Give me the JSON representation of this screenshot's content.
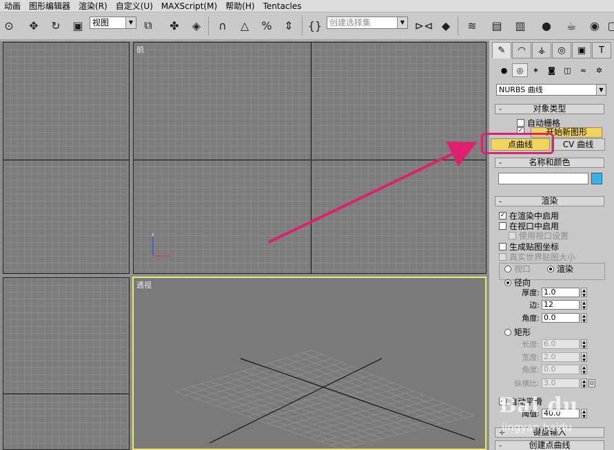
{
  "menu": [
    "动画",
    "图形编辑器",
    "渲染(R)",
    "自定义(U)",
    "MAXScript(M)",
    "帮助(H)",
    "Tentacles"
  ],
  "toolbar": {
    "view_combo": "视图",
    "selection_set_placeholder": "创建选择集",
    "icons": [
      "select-icon",
      "move-icon",
      "rotate-icon",
      "scale-icon",
      "snap-icon",
      "angle-snap-icon",
      "percent-snap-icon",
      "spinner-snap-icon",
      "mirror-icon",
      "align-icon",
      "layer-icon",
      "curve-editor-icon",
      "schematic-icon",
      "material-editor-icon",
      "render-setup-icon",
      "render-icon"
    ]
  },
  "viewports": {
    "front_label": "前",
    "perspective_label": "透视"
  },
  "panel": {
    "tabs": [
      "create-tab",
      "modify-tab",
      "hierarchy-tab",
      "motion-tab",
      "display-tab",
      "utilities-tab"
    ],
    "sub_tabs": [
      "geometry-icon",
      "shapes-icon",
      "lights-icon",
      "cameras-icon",
      "helpers-icon",
      "spacewarps-icon",
      "systems-icon"
    ],
    "category": "NURBS 曲线",
    "object_type": {
      "title": "对象类型",
      "auto_grid": "自动栅格",
      "start_new_shape": "开始新图形",
      "point_curve": "点曲线",
      "cv_curve": "CV 曲线"
    },
    "name_color": {
      "title": "名称和颜色",
      "swatch": "#34b4e8"
    },
    "rendering": {
      "title": "渲染",
      "enable_in_renderer": "在渲染中启用",
      "enable_in_viewport": "在视口中启用",
      "use_viewport_settings": "使用视口设置",
      "generate_mapping": "生成贴图坐标",
      "real_world_map": "真实世界贴图大小",
      "viewport": "视口",
      "renderer": "渲染",
      "radial": "径向",
      "thickness_label": "厚度:",
      "thickness": "1.0",
      "sides_label": "边:",
      "sides": "12",
      "angle_label": "角度:",
      "angle": "0.0",
      "rectangular": "矩形",
      "length_label": "长度:",
      "length": "6.0",
      "width_label": "宽度:",
      "width": "2.0",
      "angle2_label": "角度:",
      "angle2": "0.0",
      "aspect_label": "纵横比:",
      "aspect": "3.0",
      "auto_smooth": "自动平滑",
      "threshold_label": "阈值:",
      "threshold": "40.0"
    },
    "keyboard_entry": "键盘输入",
    "create_point_curve": "创建点曲线"
  },
  "watermark": {
    "logo": "Bai du",
    "sub": "jingyan.baidu"
  },
  "colors": {
    "highlight": "#e0206e",
    "active_viewport": "#f0e86a",
    "button_yellow": "#f2d45a"
  }
}
